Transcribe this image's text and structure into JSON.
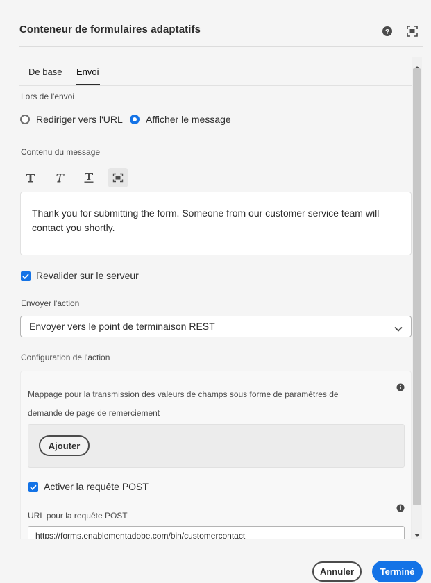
{
  "dialog": {
    "title": "Conteneur de formulaires adaptatifs",
    "icons": {
      "help": "help-circle-icon",
      "fullscreen": "fullscreen-icon"
    }
  },
  "tabs": [
    {
      "label": "De base",
      "active": false
    },
    {
      "label": "Envoi",
      "active": true
    }
  ],
  "on_submit": {
    "label": "Lors de l'envoi",
    "options": [
      {
        "label": "Rediriger vers l'URL",
        "selected": false
      },
      {
        "label": "Afficher le message",
        "selected": true
      }
    ]
  },
  "message": {
    "label": "Contenu du message",
    "toolbar": [
      "bold-text-icon",
      "italic-text-icon",
      "underline-text-icon",
      "fullscreen-icon"
    ],
    "text": "Thank you for submitting the form. Someone from our customer service  team will contact you shortly."
  },
  "revalidate": {
    "label": "Revalider sur le serveur",
    "checked": true
  },
  "submit_action": {
    "label": "Envoyer l'action",
    "value": "Envoyer vers le point de terminaison REST"
  },
  "action_config": {
    "label": "Configuration de l'action",
    "mapping_description": "Mappage pour la transmission des valeurs de champs sous forme de paramètres de demande de page de remerciement",
    "add_button": "Ajouter",
    "post_request": {
      "label": "Activer la requête POST",
      "checked": true
    },
    "post_url": {
      "label": "URL pour la requête POST",
      "value": "https://forms.enablementadobe.com/bin/customercontact"
    }
  },
  "footer": {
    "cancel": "Annuler",
    "done": "Terminé"
  },
  "colors": {
    "accent": "#1473e6",
    "text": "#2c2c2c",
    "background": "#f5f5f5"
  }
}
